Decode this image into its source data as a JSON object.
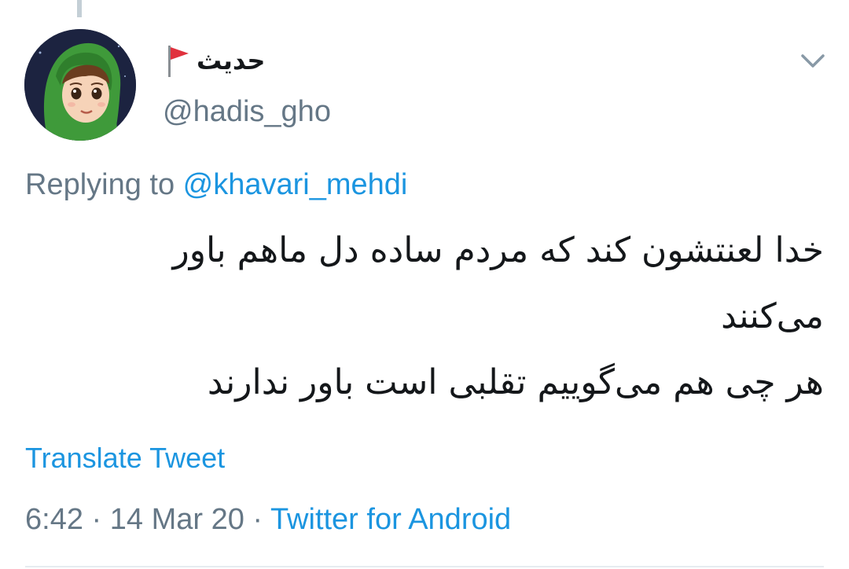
{
  "author": {
    "display_name": "حدیث",
    "handle": "@hadis_gho",
    "name_emoji_icon": "triangular-flag-icon",
    "avatar_icon": "avatar-hijab-girl-illustration"
  },
  "reply": {
    "prefix": "Replying to ",
    "mention": "@khavari_mehdi"
  },
  "tweet": {
    "lines": [
      "خدا لعنتشون کند که مردم ساده دل ماهم باور",
      "می‌کنند",
      "هر چی هم می‌گوییم تقلبی است باور ندارند"
    ]
  },
  "actions": {
    "translate_label": "Translate Tweet",
    "menu_icon": "chevron-down-icon"
  },
  "meta": {
    "time": "6:42",
    "separator": " · ",
    "date": "14 Mar 20",
    "source": "Twitter for Android"
  },
  "colors": {
    "link": "#1b95e0",
    "secondary_text": "#657786",
    "primary_text": "#14171a",
    "flag_red": "#e0323e"
  }
}
